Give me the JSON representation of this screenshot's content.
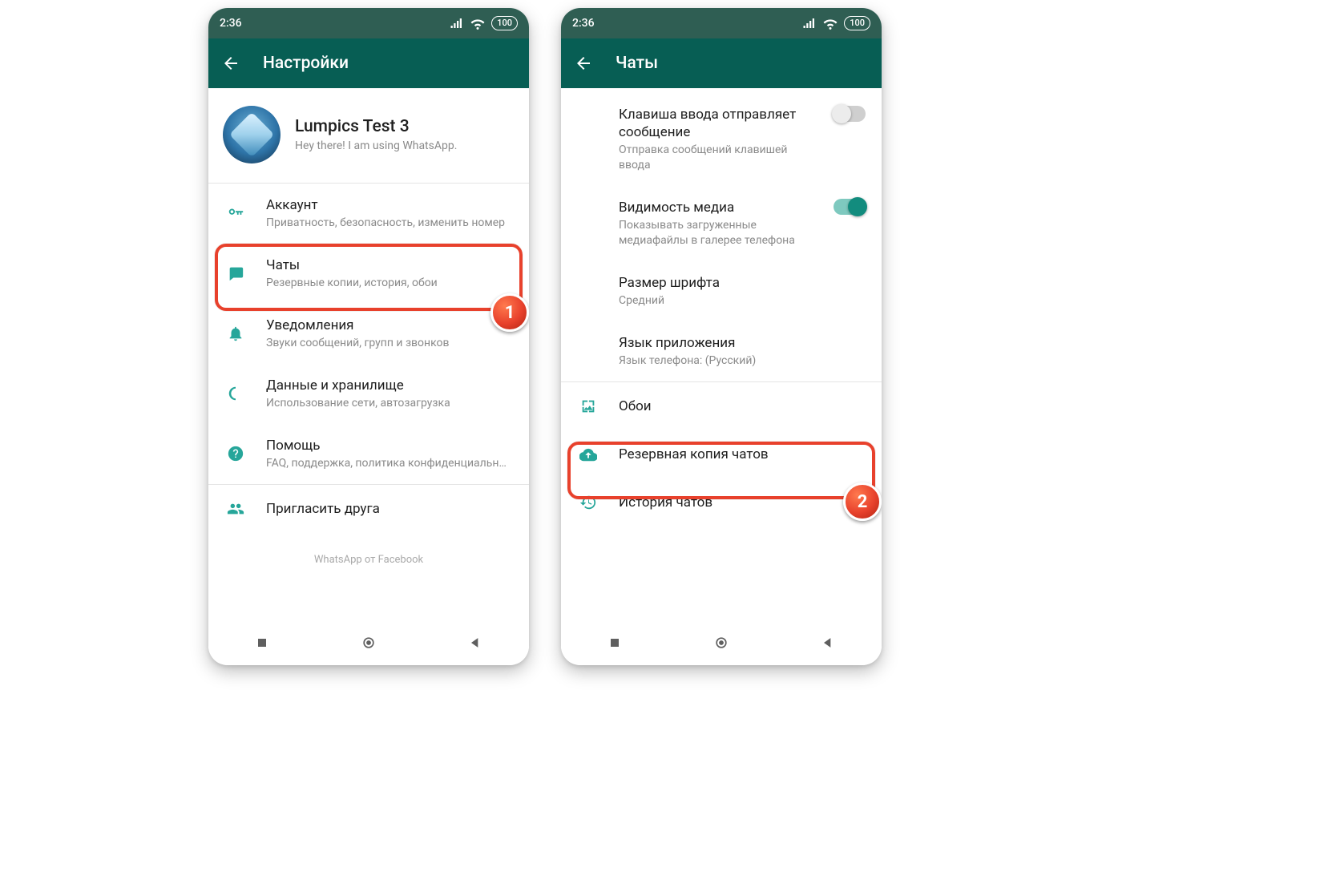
{
  "status": {
    "time": "2:36",
    "battery": "100"
  },
  "left": {
    "title": "Настройки",
    "profile": {
      "name": "Lumpics Test 3",
      "status": "Hey there! I am using WhatsApp."
    },
    "items": [
      {
        "title": "Аккаунт",
        "sub": "Приватность, безопасность, изменить номер"
      },
      {
        "title": "Чаты",
        "sub": "Резервные копии, история, обои"
      },
      {
        "title": "Уведомления",
        "sub": "Звуки сообщений, групп и звонков"
      },
      {
        "title": "Данные и хранилище",
        "sub": "Использование сети, автозагрузка"
      },
      {
        "title": "Помощь",
        "sub": "FAQ, поддержка, политика конфиденциальн…"
      },
      {
        "title": "Пригласить друга",
        "sub": ""
      }
    ],
    "footer": "WhatsApp от Facebook"
  },
  "right": {
    "title": "Чаты",
    "rows": [
      {
        "title": "Клавиша ввода отправляет сообщение",
        "sub": "Отправка сообщений клавишей ввода",
        "toggle": "off"
      },
      {
        "title": "Видимость медиа",
        "sub": "Показывать загруженные медиафайлы в галерее телефона",
        "toggle": "on"
      },
      {
        "title": "Размер шрифта",
        "sub": "Средний"
      },
      {
        "title": "Язык приложения",
        "sub": "Язык телефона: (Русский)"
      }
    ],
    "extra": [
      {
        "title": "Обои"
      },
      {
        "title": "Резервная копия чатов"
      },
      {
        "title": "История чатов"
      }
    ]
  },
  "annotations": {
    "one": "1",
    "two": "2"
  }
}
